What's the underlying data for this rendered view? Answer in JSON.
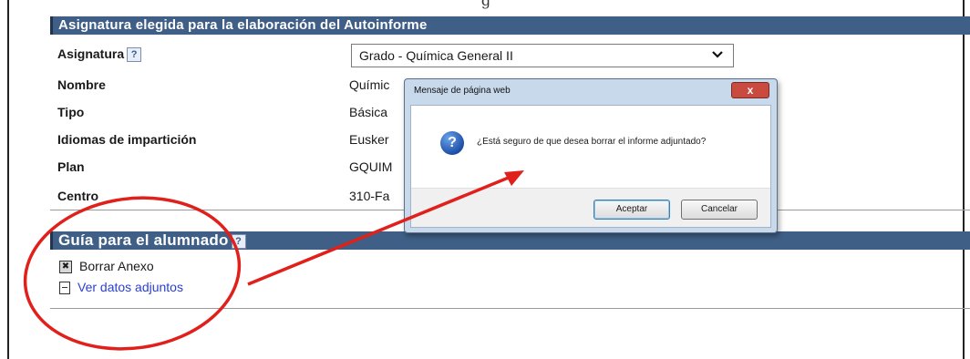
{
  "page_heading_partial": "g",
  "section1": {
    "header": "Asignatura elegida para la elaboración del Autoinforme",
    "rows": [
      {
        "label": "Asignatura",
        "value": ""
      },
      {
        "label": "Nombre",
        "value": "Químic"
      },
      {
        "label": "Tipo",
        "value": "Básica"
      },
      {
        "label": "Idiomas de impartición",
        "value": "Eusker"
      },
      {
        "label": "Plan",
        "value": "GQUIM"
      },
      {
        "label": "Centro",
        "value": "310-Fa"
      }
    ],
    "select_value": "Grado - Química General II",
    "help_glyph": "?"
  },
  "section2": {
    "header": "Guía para el alumnado",
    "help_glyph": "?",
    "delete_label": "Borrar Anexo",
    "view_label": "Ver datos adjuntos"
  },
  "dialog": {
    "title": "Mensaje de página web",
    "close_glyph": "x",
    "message": "¿Está seguro de que desea borrar el informe adjuntado?",
    "ok_label": "Aceptar",
    "cancel_label": "Cancelar",
    "icon": "question-icon"
  },
  "annotation_color": "#e0201b"
}
